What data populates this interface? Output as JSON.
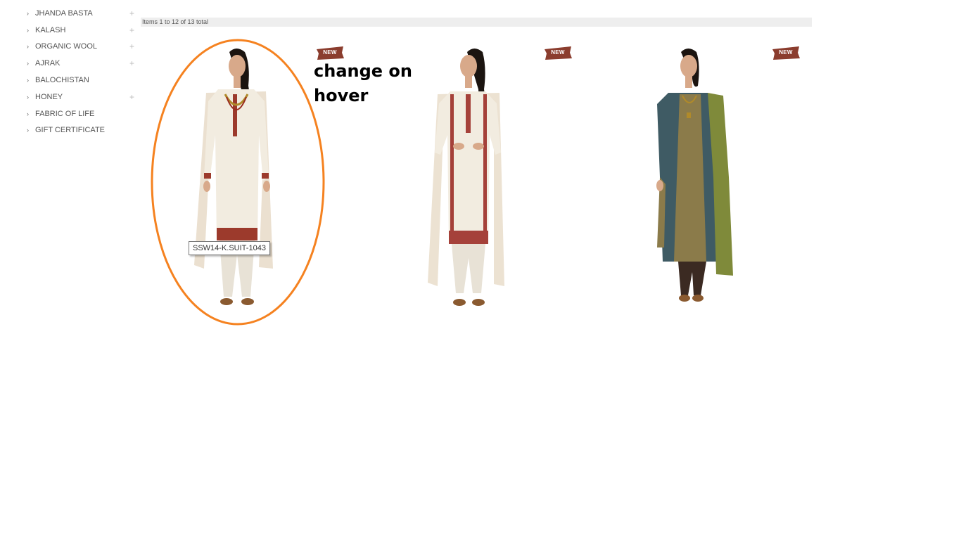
{
  "sidebar": {
    "categories": [
      {
        "label": "JHANDA BASTA",
        "expandable": true
      },
      {
        "label": "KALASH",
        "expandable": true
      },
      {
        "label": "ORGANIC WOOL",
        "expandable": true
      },
      {
        "label": "AJRAK",
        "expandable": true
      },
      {
        "label": "BALOCHISTAN",
        "expandable": false
      },
      {
        "label": "HONEY",
        "expandable": true
      },
      {
        "label": "FABRIC OF LIFE",
        "expandable": false
      },
      {
        "label": "GIFT CERTIFICATE",
        "expandable": false
      }
    ],
    "arrow_glyph": "›",
    "plus_glyph": "+"
  },
  "toolbar": {
    "items_count": "Items 1 to 12 of 13 total"
  },
  "products": [
    {
      "badge": "NEW",
      "tooltip": "SSW14-K.SUIT-1043",
      "colors": {
        "kameez": "#f2ece0",
        "trim": "#9c3a2c",
        "dupatta": "#ebe0d0",
        "pants": "#e8e2d6"
      }
    },
    {
      "badge": "NEW",
      "colors": {
        "kameez": "#f2ece0",
        "trim": "#a5413a",
        "dupatta": "#ece2d2",
        "pants": "#e8e2d6"
      }
    },
    {
      "badge": "NEW",
      "colors": {
        "kameez": "#3f5b64",
        "trim": "#8b7b4a",
        "dupatta": "#7f8a3a",
        "pants": "#3b2a22"
      }
    }
  ],
  "annotation": {
    "text": "change on hover",
    "color": "#f58220"
  },
  "colors": {
    "badge": "#8b3d2e",
    "toolbar_bg": "#eeeeee"
  }
}
